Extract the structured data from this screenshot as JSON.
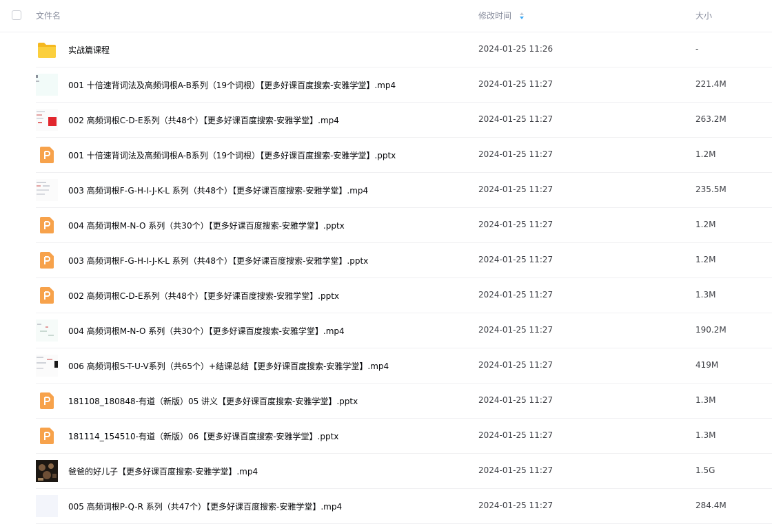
{
  "header": {
    "name_label": "文件名",
    "modified_label": "修改时间",
    "size_label": "大小"
  },
  "files": [
    {
      "name": "实战篇课程",
      "modified": "2024-01-25 11:26",
      "size": "-",
      "type": "folder-icon"
    },
    {
      "name": "001 十倍速背词法及高频词根A-B系列（19个词根）【更多好课百度搜索-安雅学堂】.mp4",
      "modified": "2024-01-25 11:27",
      "size": "221.4M",
      "type": "video-thumbnail"
    },
    {
      "name": "002 高频词根C-D-E系列（共48个）【更多好课百度搜索-安雅学堂】.mp4",
      "modified": "2024-01-25 11:27",
      "size": "263.2M",
      "type": "video-thumbnail"
    },
    {
      "name": "001 十倍速背词法及高频词根A-B系列（19个词根）【更多好课百度搜索-安雅学堂】.pptx",
      "modified": "2024-01-25 11:27",
      "size": "1.2M",
      "type": "pptx-icon"
    },
    {
      "name": "003 高频词根F-G-H-I-J-K-L 系列（共48个）【更多好课百度搜索-安雅学堂】.mp4",
      "modified": "2024-01-25 11:27",
      "size": "235.5M",
      "type": "video-thumbnail"
    },
    {
      "name": "004 高频词根M-N-O 系列（共30个）【更多好课百度搜索-安雅学堂】.pptx",
      "modified": "2024-01-25 11:27",
      "size": "1.2M",
      "type": "pptx-icon"
    },
    {
      "name": "003 高频词根F-G-H-I-J-K-L 系列（共48个）【更多好课百度搜索-安雅学堂】.pptx",
      "modified": "2024-01-25 11:27",
      "size": "1.2M",
      "type": "pptx-icon"
    },
    {
      "name": "002 高频词根C-D-E系列（共48个）【更多好课百度搜索-安雅学堂】.pptx",
      "modified": "2024-01-25 11:27",
      "size": "1.3M",
      "type": "pptx-icon"
    },
    {
      "name": "004 高频词根M-N-O 系列（共30个）【更多好课百度搜索-安雅学堂】.mp4",
      "modified": "2024-01-25 11:27",
      "size": "190.2M",
      "type": "video-thumbnail"
    },
    {
      "name": "006 高频词根S-T-U-V系列（共65个）+结课总结【更多好课百度搜索-安雅学堂】.mp4",
      "modified": "2024-01-25 11:27",
      "size": "419M",
      "type": "video-thumbnail"
    },
    {
      "name": "181108_180848-有道（新版）05 讲义【更多好课百度搜索-安雅学堂】.pptx",
      "modified": "2024-01-25 11:27",
      "size": "1.3M",
      "type": "pptx-icon"
    },
    {
      "name": "181114_154510-有道（新版）06【更多好课百度搜索-安雅学堂】.pptx",
      "modified": "2024-01-25 11:27",
      "size": "1.3M",
      "type": "pptx-icon"
    },
    {
      "name": "爸爸的好儿子【更多好课百度搜索-安雅学堂】.mp4",
      "modified": "2024-01-25 11:27",
      "size": "1.5G",
      "type": "video-thumbnail"
    },
    {
      "name": "005 高频词根P-Q-R 系列（共47个）【更多好课百度搜索-安雅学堂】.mp4",
      "modified": "2024-01-25 11:27",
      "size": "284.4M",
      "type": "video-thumbnail"
    }
  ],
  "colors": {
    "folder": "#f9c531",
    "pptx": "#f7a24b",
    "sort_accent": "#3da8f5"
  }
}
